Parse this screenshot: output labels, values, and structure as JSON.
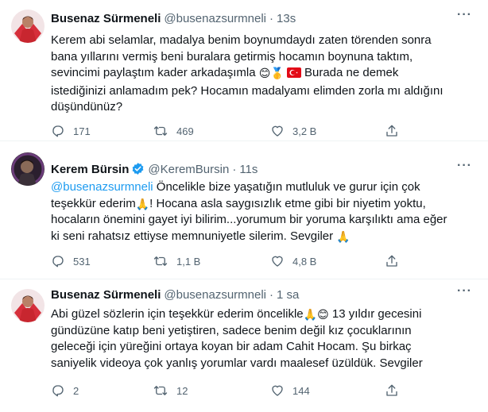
{
  "tweets": [
    {
      "name": "Busenaz Sürmeneli",
      "handle": "@busenazsurmneli",
      "time": "13s",
      "verified": false,
      "text_parts": {
        "p1": "Kerem abi selamlar, madalya benim boynumdaydı zaten törenden sonra",
        "p2": "bana yıllarını vermiş beni buralara getirmiş hocamın boynuna taktım,",
        "p3": "sevincimi paylaştım kader arkadaşımla ",
        "p3b": " Burada ne demek",
        "p4": "istediğinizi anlamadım pek? Hocamın madalyamı elimden zorla mı aldığını",
        "p5": "düşündünüz?"
      },
      "replies": "171",
      "retweets": "469",
      "likes": "3,2 B"
    },
    {
      "name": "Kerem Bürsin",
      "handle": "@KeremBursin",
      "time": "11s",
      "verified": true,
      "text_parts": {
        "mention": "@busenazsurmneli",
        "p1": " Öncelikle bize yaşatığın mutluluk ve gurur için çok",
        "p2": "teşekkür ederim",
        "p2b": "! Hocana asla saygısızlık etme gibi bir niyetim yoktu,",
        "p3": "hocaların önemini gayet iyi bilirim...yorumum bir yoruma karşılıktı ama eğer",
        "p4": "ki seni rahatsız ettiyse memnuniyetle silerim. Sevgiler "
      },
      "replies": "531",
      "retweets": "1,1 B",
      "likes": "4,8 B"
    },
    {
      "name": "Busenaz Sürmeneli",
      "handle": "@busenazsurmneli",
      "time": "1 sa",
      "verified": false,
      "text_parts": {
        "p1": "Abi güzel sözlerin için teşekkür ederim öncelikle",
        "p1b": " 13 yıldır gecesini",
        "p2": "gündüzüne katıp beni yetiştiren, sadece benim değil kız çocuklarının",
        "p3": "geleceği için yüreğini ortaya koyan bir adam Cahit Hocam. Şu birkaç",
        "p4": "saniyelik videoya çok yanlış yorumlar vardı maalesef üzüldük. Sevgiler"
      },
      "replies": "2",
      "retweets": "12",
      "likes": "144"
    }
  ],
  "icons": {
    "reply": "speech-bubble-icon",
    "retweet": "retweet-arrows-icon",
    "like": "heart-icon",
    "share": "share-upload-icon",
    "more": "more-dots-icon",
    "verified": "verified-badge-icon"
  },
  "colors": {
    "text": "#0f1419",
    "secondary": "#536471",
    "link": "#1d9bf0",
    "verified": "#1d9bf0",
    "divider": "#eff3f4"
  },
  "more_label": "···",
  "emoji": {
    "smile": "😊",
    "medal": "🥇",
    "flag": "TR",
    "pray": "🙏"
  }
}
